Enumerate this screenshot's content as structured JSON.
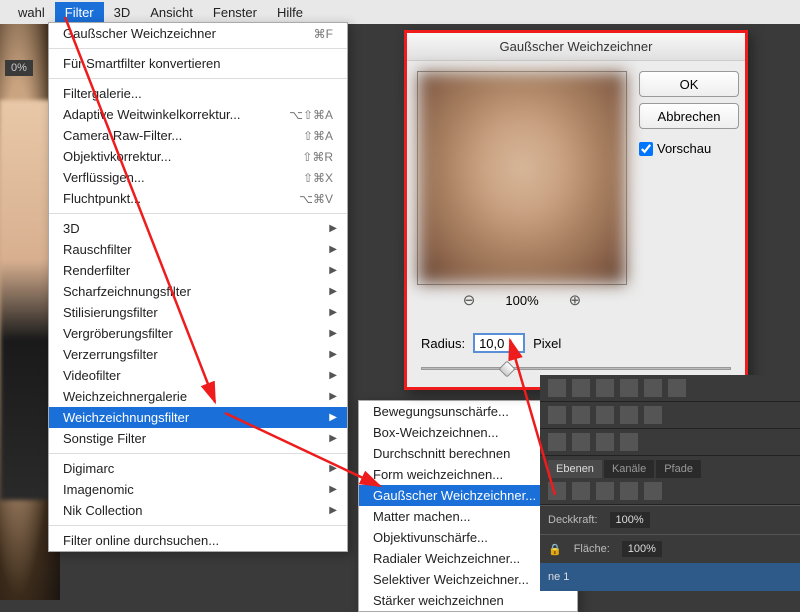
{
  "menubar": {
    "items": [
      "wahl",
      "Filter",
      "3D",
      "Ansicht",
      "Fenster",
      "Hilfe"
    ],
    "active_index": 1
  },
  "zoom_indicator": "0%",
  "dropdown": {
    "last_filter": {
      "label": "Gaußscher Weichzeichner",
      "shortcut": "⌘F"
    },
    "convert": "Für Smartfilter konvertieren",
    "group1": [
      {
        "label": "Filtergalerie..."
      },
      {
        "label": "Adaptive Weitwinkelkorrektur...",
        "shortcut": "⌥⇧⌘A"
      },
      {
        "label": "Camera Raw-Filter...",
        "shortcut": "⇧⌘A"
      },
      {
        "label": "Objektivkorrektur...",
        "shortcut": "⇧⌘R"
      },
      {
        "label": "Verflüssigen...",
        "shortcut": "⇧⌘X"
      },
      {
        "label": "Fluchtpunkt...",
        "shortcut": "⌥⌘V"
      }
    ],
    "group2": [
      "3D",
      "Rauschfilter",
      "Renderfilter",
      "Scharfzeichnungsfilter",
      "Stilisierungsfilter",
      "Vergröberungsfilter",
      "Verzerrungsfilter",
      "Videofilter",
      "Weichzeichnergalerie",
      "Weichzeichnungsfilter",
      "Sonstige Filter"
    ],
    "group2_hi_index": 9,
    "group3": [
      "Digimarc",
      "Imagenomic",
      "Nik Collection"
    ],
    "online": "Filter online durchsuchen..."
  },
  "submenu": {
    "items": [
      "Bewegungsunschärfe...",
      "Box-Weichzeichnen...",
      "Durchschnitt berechnen",
      "Form weichzeichnen...",
      "Gaußscher Weichzeichner...",
      "Matter machen...",
      "Objektivunschärfe...",
      "Radialer Weichzeichner...",
      "Selektiver Weichzeichner...",
      "Stärker weichzeichnen"
    ],
    "hi_index": 4
  },
  "dialog": {
    "title": "Gaußscher Weichzeichner",
    "ok": "OK",
    "cancel": "Abbrechen",
    "preview_label": "Vorschau",
    "zoom": "100%",
    "radius_label": "Radius:",
    "radius_value": "10,0",
    "radius_unit": "Pixel"
  },
  "panels": {
    "tabs1": [
      "Ebenen",
      "Kanäle",
      "Pfade"
    ],
    "opacity_label": "Deckkraft:",
    "opacity_value": "100%",
    "fill_label": "Fläche:",
    "fill_value": "100%",
    "layer_name": "ne 1"
  }
}
